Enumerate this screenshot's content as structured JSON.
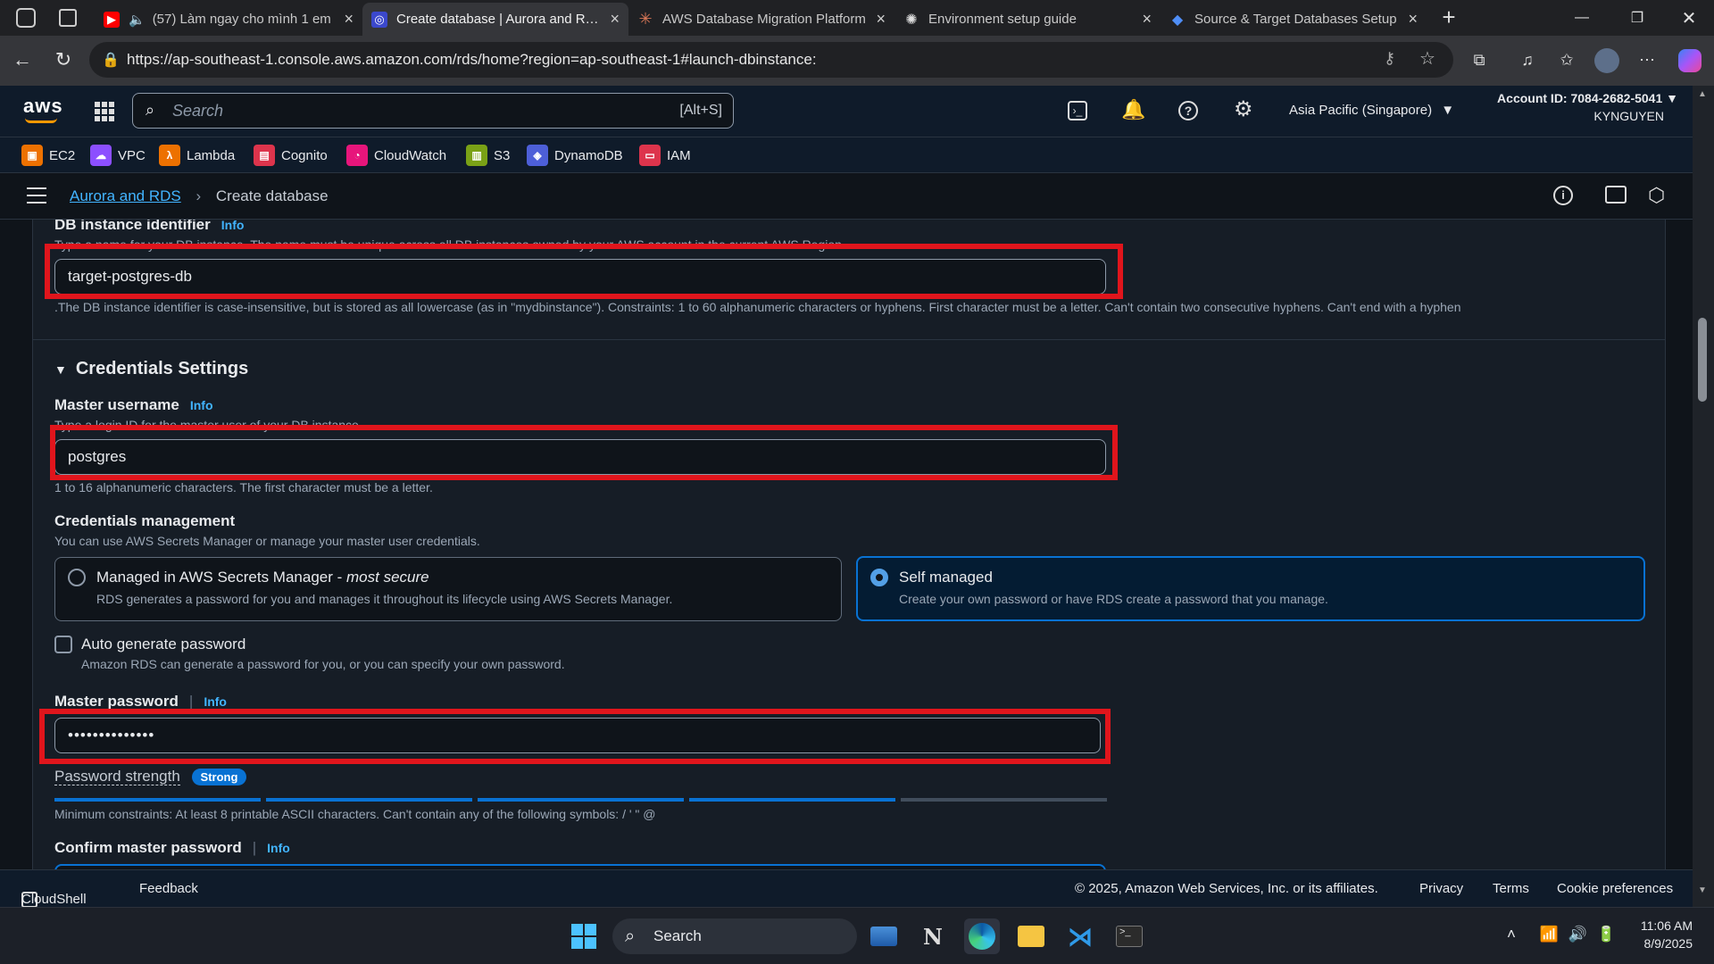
{
  "browser": {
    "tabs": [
      {
        "title": "(57) Làm ngay cho mình 1 em",
        "favicon": "youtube-icon",
        "color": "#ff0000"
      },
      {
        "title": "Create database | Aurora and RDS",
        "favicon": "rds-icon",
        "color": "#3b48cc"
      },
      {
        "title": "AWS Database Migration Platform",
        "favicon": "claude-icon",
        "color": "#d97757"
      },
      {
        "title": "Environment setup guide",
        "favicon": "chatgpt-icon",
        "color": "#e0e0e0"
      },
      {
        "title": "Source & Target Databases Setup",
        "favicon": "gemini-icon",
        "color": "#4f8ef7"
      }
    ],
    "url": "https://ap-southeast-1.console.aws.amazon.com/rds/home?region=ap-southeast-1#launch-dbinstance:"
  },
  "aws_header": {
    "logo": "aws",
    "search_placeholder": "Search",
    "search_shortcut": "[Alt+S]",
    "region": "Asia Pacific (Singapore)",
    "account_id": "Account ID: 7084-2682-5041",
    "username": "KYNGUYEN"
  },
  "favorites": [
    {
      "label": "EC2",
      "color": "#ed7100"
    },
    {
      "label": "VPC",
      "color": "#8c4fff"
    },
    {
      "label": "Lambda",
      "color": "#ed7100"
    },
    {
      "label": "Cognito",
      "color": "#dd344c"
    },
    {
      "label": "CloudWatch",
      "color": "#e7157b"
    },
    {
      "label": "S3",
      "color": "#7aa116"
    },
    {
      "label": "DynamoDB",
      "color": "#4d5fd8"
    },
    {
      "label": "IAM",
      "color": "#dd344c"
    }
  ],
  "breadcrumb": {
    "parent": "Aurora and RDS",
    "current": "Create database"
  },
  "form": {
    "db_identifier": {
      "label": "DB instance identifier",
      "info": "Info",
      "description": "Type a name for your DB instance. The name must be unique across all DB instances owned by your AWS account in the current AWS Region.",
      "value": "target-postgres-db",
      "constraint": "The DB instance identifier is case-insensitive, but is stored as all lowercase (as in \"mydbinstance\"). Constraints: 1 to 60 alphanumeric characters or hyphens. First character must be a letter. Can't contain two consecutive hyphens. Can't end with a hyphen."
    },
    "credentials_section": "Credentials Settings",
    "master_username": {
      "label": "Master username",
      "info": "Info",
      "description": "Type a login ID for the master user of your DB instance.",
      "value": "postgres",
      "constraint": "1 to 16 alphanumeric characters. The first character must be a letter."
    },
    "credentials_management": {
      "label": "Credentials management",
      "description": "You can use AWS Secrets Manager or manage your master user credentials.",
      "options": [
        {
          "title": "Managed in AWS Secrets Manager - ",
          "title_emph": "most secure",
          "desc": "RDS generates a password for you and manages it throughout its lifecycle using AWS Secrets Manager.",
          "selected": false
        },
        {
          "title": "Self managed",
          "title_emph": "",
          "desc": "Create your own password or have RDS create a password that you manage.",
          "selected": true
        }
      ]
    },
    "auto_generate": {
      "label": "Auto generate password",
      "description": "Amazon RDS can generate a password for you, or you can specify your own password.",
      "checked": false
    },
    "master_password": {
      "label": "Master password",
      "info": "Info",
      "value": "••••••••••••••",
      "strength_label": "Password strength",
      "strength_value": "Strong",
      "strength_level": 0.8,
      "constraint": "Minimum constraints: At least 8 printable ASCII characters. Can't contain any of the following symbols: / ' \" @"
    },
    "confirm_password": {
      "label": "Confirm master password",
      "info": "Info"
    }
  },
  "footer": {
    "cloudshell": "CloudShell",
    "feedback": "Feedback",
    "copyright": "© 2025, Amazon Web Services, Inc. or its affiliates.",
    "privacy": "Privacy",
    "terms": "Terms",
    "cookies": "Cookie preferences"
  },
  "taskbar": {
    "search": "Search",
    "time": "11:06 AM",
    "date": "8/9/2025"
  }
}
